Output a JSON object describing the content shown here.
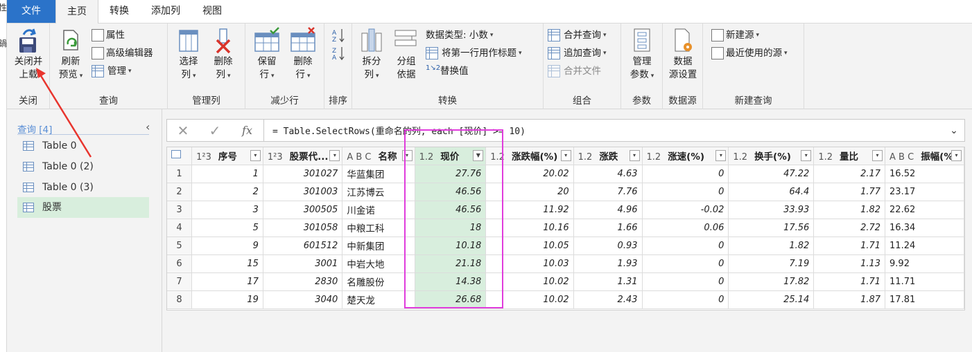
{
  "excel_strip": {
    "lines": [
      "性",
      "鍋"
    ]
  },
  "tabs": [
    {
      "label": "文件",
      "kind": "file"
    },
    {
      "label": "主页",
      "kind": "active"
    },
    {
      "label": "转换",
      "kind": ""
    },
    {
      "label": "添加列",
      "kind": ""
    },
    {
      "label": "视图",
      "kind": ""
    }
  ],
  "ribbon": {
    "close": {
      "btn": [
        "关闭并",
        "上载"
      ],
      "label": "关闭"
    },
    "query": {
      "refresh": [
        "刷新",
        "预览"
      ],
      "properties": "属性",
      "advanced_editor": "高级编辑器",
      "manage": "管理",
      "label": "查询"
    },
    "manage_cols": {
      "choose": [
        "选择",
        "列"
      ],
      "remove": [
        "删除",
        "列"
      ],
      "label": "管理列"
    },
    "reduce_rows": {
      "keep": [
        "保留",
        "行"
      ],
      "remove": [
        "删除",
        "行"
      ],
      "label": "减少行"
    },
    "sort": {
      "label": "排序"
    },
    "transform": {
      "split": [
        "拆分",
        "列"
      ],
      "group": [
        "分组",
        "依据"
      ],
      "data_type": "数据类型: 小数",
      "first_row_header": "将第一行用作标题",
      "replace": "替换值",
      "label": "转换"
    },
    "combine": {
      "merge": "合并查询",
      "append": "追加查询",
      "combine_files": "合并文件",
      "label": "组合"
    },
    "params": {
      "manage": [
        "管理",
        "参数"
      ],
      "label": "参数"
    },
    "datasource": {
      "settings": [
        "数据",
        "源设置"
      ],
      "label": "数据源"
    },
    "newquery": {
      "new_source": "新建源",
      "recent": "最近使用的源",
      "label": "新建查询"
    }
  },
  "query_pane": {
    "header": "查询 [4]",
    "items": [
      {
        "label": "Table 0",
        "selected": false
      },
      {
        "label": "Table 0 (2)",
        "selected": false
      },
      {
        "label": "Table 0 (3)",
        "selected": false
      },
      {
        "label": "股票",
        "selected": true
      }
    ]
  },
  "formula": {
    "cancel": "✕",
    "confirm": "✓",
    "fx": "fx",
    "text": "= Table.SelectRows(重命名的列, each [现价] >= 10)"
  },
  "table": {
    "columns": [
      {
        "type": "1²3",
        "name": "序号",
        "width": 104
      },
      {
        "type": "1²3",
        "name": "股票代...",
        "width": 115
      },
      {
        "type": "A B C",
        "name": "名称",
        "width": 105
      },
      {
        "type": "1.2",
        "name": "现价",
        "width": 104,
        "highlight": true
      },
      {
        "type": "1.2",
        "name": "涨跌幅(%)",
        "width": 127
      },
      {
        "type": "1.2",
        "name": "涨跌",
        "width": 100
      },
      {
        "type": "1.2",
        "name": "涨速(%)",
        "width": 126
      },
      {
        "type": "1.2",
        "name": "换手(%)",
        "width": 124
      },
      {
        "type": "1.2",
        "name": "量比",
        "width": 104
      },
      {
        "type": "A B C",
        "name": "振幅(%)",
        "width": 114
      }
    ],
    "rows": [
      [
        "1",
        "1",
        "301027",
        "华蓝集团",
        "27.76",
        "20.02",
        "4.63",
        "0",
        "47.22",
        "2.17",
        "16.52"
      ],
      [
        "2",
        "2",
        "301003",
        "江苏博云",
        "46.56",
        "20",
        "7.76",
        "0",
        "64.4",
        "1.77",
        "23.17"
      ],
      [
        "3",
        "3",
        "300505",
        "川金诺",
        "46.56",
        "11.92",
        "4.96",
        "-0.02",
        "33.93",
        "1.82",
        "22.62"
      ],
      [
        "4",
        "5",
        "301058",
        "中粮工科",
        "18",
        "10.16",
        "1.66",
        "0.06",
        "17.56",
        "2.72",
        "16.34"
      ],
      [
        "5",
        "9",
        "601512",
        "中新集团",
        "10.18",
        "10.05",
        "0.93",
        "0",
        "1.82",
        "1.71",
        "11.24"
      ],
      [
        "6",
        "15",
        "3001",
        "中岩大地",
        "21.18",
        "10.03",
        "1.93",
        "0",
        "7.19",
        "1.13",
        "9.92"
      ],
      [
        "7",
        "17",
        "2830",
        "名雕股份",
        "14.38",
        "10.02",
        "1.31",
        "0",
        "17.82",
        "1.71",
        "11.71"
      ],
      [
        "8",
        "19",
        "3040",
        "楚天龙",
        "26.68",
        "10.02",
        "2.43",
        "0",
        "25.14",
        "1.87",
        "17.81"
      ]
    ]
  },
  "colors": {
    "accent": "#2b73c9",
    "highlight": "#d8eedd",
    "annotation": "#e03cdc",
    "arrow": "#e8352e"
  }
}
